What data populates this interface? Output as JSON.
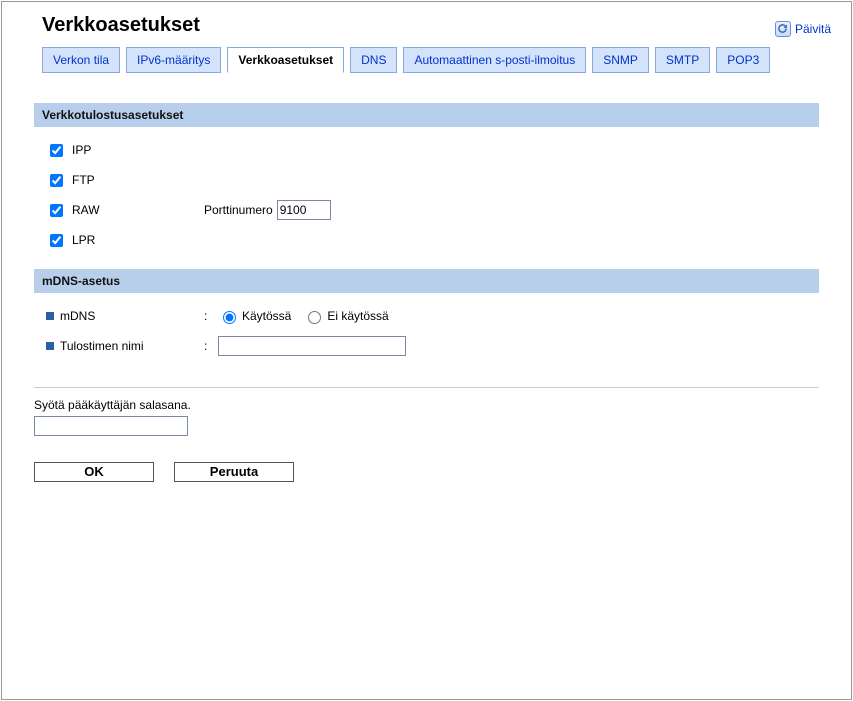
{
  "page_title": "Verkkoasetukset",
  "refresh_label": "Päivitä",
  "tabs": {
    "t0": "Verkon tila",
    "t1": "IPv6-määritys",
    "t2": "Verkkoasetukset",
    "t3": "DNS",
    "t4": "Automaattinen s-posti-ilmoitus",
    "t5": "SNMP",
    "t6": "SMTP",
    "t7": "POP3"
  },
  "sections": {
    "print": {
      "title": "Verkkotulostusasetukset",
      "ipp": "IPP",
      "ftp": "FTP",
      "raw": "RAW",
      "port_label": "Porttinumero",
      "port_value": "9100",
      "lpr": "LPR"
    },
    "mdns": {
      "title": "mDNS-asetus",
      "mdns_label": "mDNS",
      "enabled": "Käytössä",
      "disabled": "Ei käytössä",
      "printer_name_label": "Tulostimen nimi",
      "printer_name_value": ""
    }
  },
  "password_prompt": "Syötä pääkäyttäjän salasana.",
  "password_value": "",
  "buttons": {
    "ok": "OK",
    "cancel": "Peruuta"
  }
}
